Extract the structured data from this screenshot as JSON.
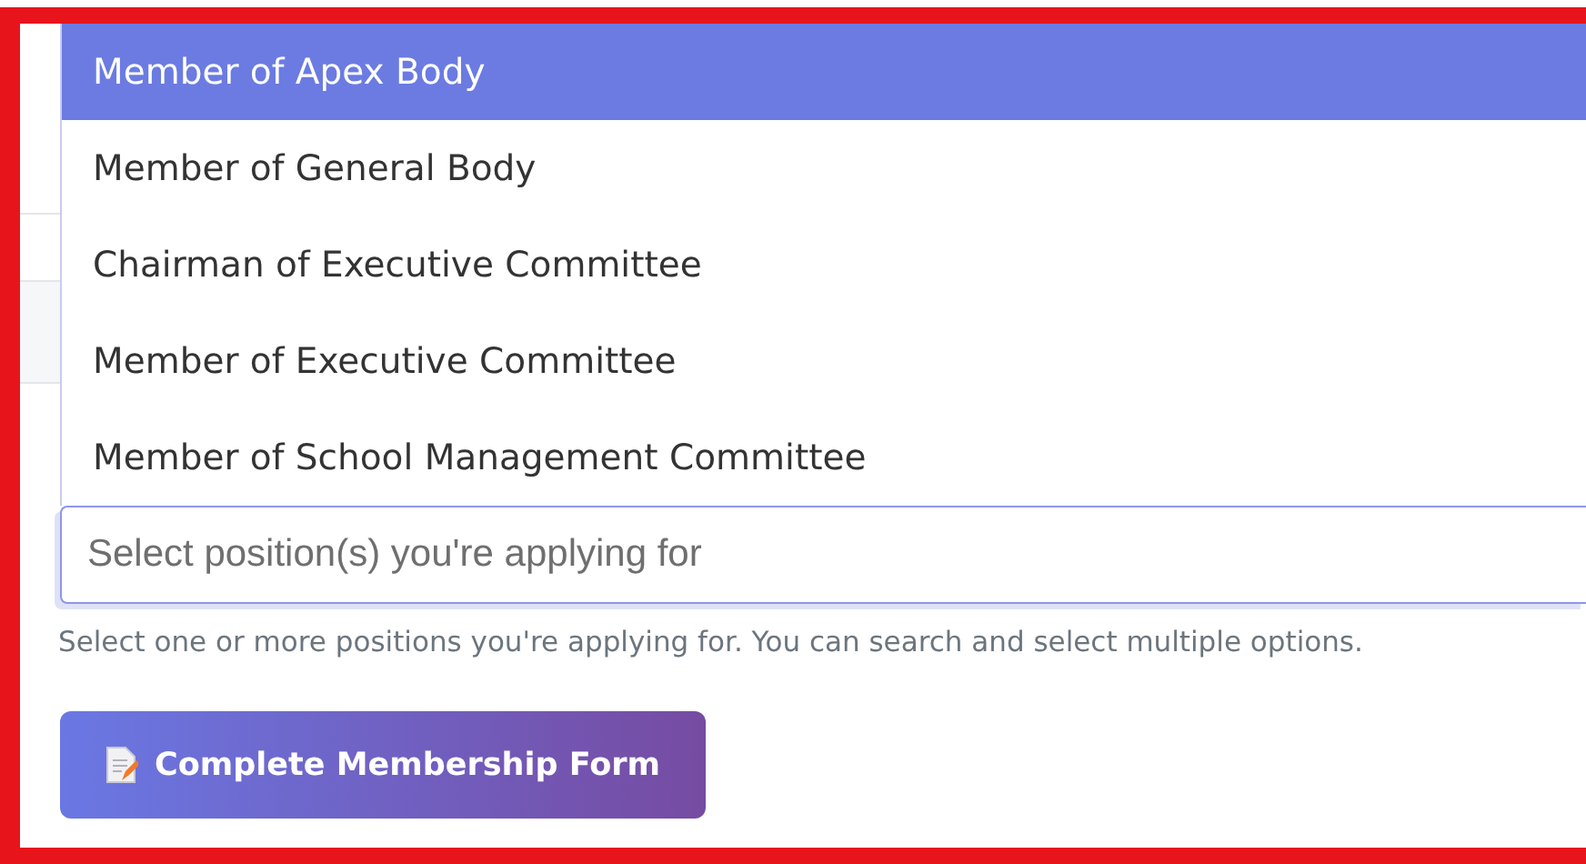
{
  "dropdown": {
    "options": [
      {
        "label": "Member of Apex Body",
        "selected": true
      },
      {
        "label": "Member of General Body",
        "selected": false
      },
      {
        "label": "Chairman of Executive Committee",
        "selected": false
      },
      {
        "label": "Member of Executive Committee",
        "selected": false
      },
      {
        "label": "Member of School Management Committee",
        "selected": false
      }
    ]
  },
  "positions_field": {
    "placeholder": "Select position(s) you're applying for"
  },
  "help_text": "Select one or more positions you're applying for. You can search and select multiple options.",
  "submit_button": {
    "label": "Complete Membership Form"
  }
}
